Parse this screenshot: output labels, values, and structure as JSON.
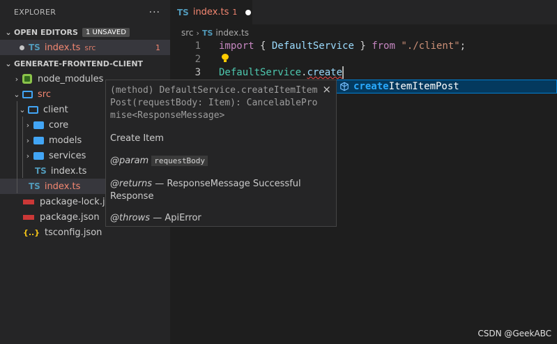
{
  "sidebar": {
    "title": "EXPLORER",
    "more": "···",
    "open_editors": {
      "label": "OPEN EDITORS",
      "badge": "1 UNSAVED",
      "items": [
        {
          "icon": "TS",
          "name": "index.ts",
          "desc": "src",
          "count": "1"
        }
      ]
    },
    "project": {
      "label": "GENERATE-FRONTEND-CLIENT",
      "node_modules": "node_modules",
      "src": "src",
      "client": "client",
      "core": "core",
      "models": "models",
      "services": "services",
      "client_index": "index.ts",
      "src_index": "index.ts",
      "package_lock": "package-lock.json",
      "package_json": "package.json",
      "tsconfig": "tsconfig.json"
    }
  },
  "editor": {
    "tab": {
      "icon": "TS",
      "label": "index.ts",
      "count": "1"
    },
    "breadcrumb": {
      "folder": "src",
      "file_icon": "TS",
      "file": "index.ts"
    },
    "line_numbers": [
      "1",
      "2",
      "3"
    ],
    "line1": {
      "kw1": "import",
      "p1": " { ",
      "id": "DefaultService",
      "p2": " } ",
      "kw2": "from",
      "sp": " ",
      "str": "\"./client\"",
      "semi": ";"
    },
    "line3": {
      "cls": "DefaultService",
      "dot": ".",
      "typed": "create"
    }
  },
  "suggest": {
    "match": "create",
    "rest": "ItemItemPost"
  },
  "details": {
    "close": "×",
    "signature": "(method) DefaultService.createItemItemPost(requestBody: Item): CancelablePromise<ResponseMessage>",
    "description": "Create Item",
    "param_tag": "@param",
    "param_name": "requestBody",
    "returns_tag": "@returns",
    "returns_text": "— ResponseMessage Successful",
    "returns_text2": "Response",
    "throws_tag": "@throws",
    "throws_text": "— ApiError"
  },
  "watermark": "CSDN @GeekABC"
}
